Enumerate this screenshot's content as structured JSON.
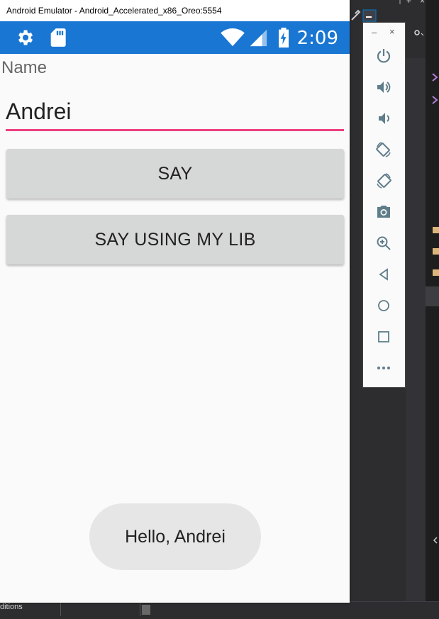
{
  "window": {
    "title": "Android Emulator - Android_Accelerated_x86_Oreo:5554"
  },
  "status_bar": {
    "time": "2:09",
    "color": "#1976d2"
  },
  "form": {
    "name_label": "Name",
    "name_value": "Andrei",
    "underline_color": "#ee4080"
  },
  "buttons": {
    "say": "SAY",
    "say_lib": "SAY USING MY LIB"
  },
  "toast": {
    "text": "Hello, Andrei"
  },
  "toolbar": {
    "minimize": "–",
    "close": "×",
    "icons": [
      "power-icon",
      "volume-up-icon",
      "volume-down-icon",
      "rotate-left-icon",
      "rotate-right-icon",
      "camera-icon",
      "zoom-icon",
      "back-icon",
      "home-icon",
      "overview-icon",
      "more-icon"
    ]
  },
  "ide": {
    "bottom_text": "ditions"
  }
}
